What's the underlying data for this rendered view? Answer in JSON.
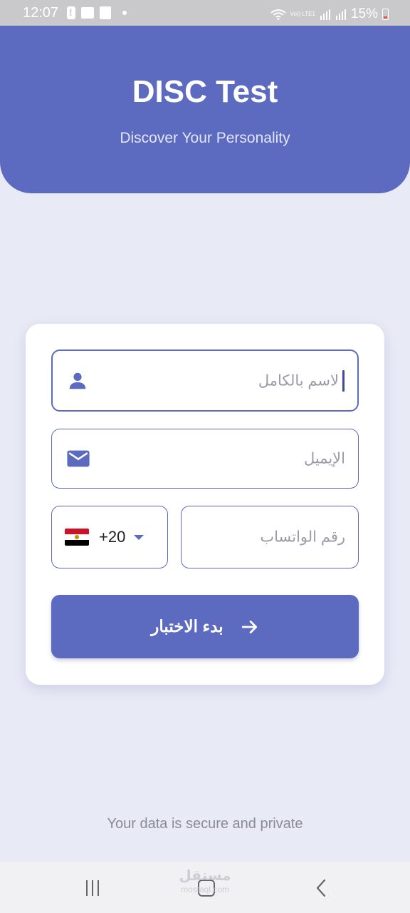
{
  "status_bar": {
    "time": "12:07",
    "volte_label": "Vo)) LTE1",
    "battery_text": "15%"
  },
  "header": {
    "title": "DISC Test",
    "subtitle": "Discover Your Personality"
  },
  "form": {
    "full_name": {
      "placeholder": "لاسم بالكامل",
      "icon": "person-icon"
    },
    "email": {
      "placeholder": "الإيميل",
      "icon": "mail-icon"
    },
    "phone": {
      "placeholder": "رقم الواتساب"
    },
    "country": {
      "dial_code": "+20",
      "flag": "egypt-flag-icon"
    },
    "submit_label": "بدء الاختبار",
    "submit_icon": "arrow-right-icon"
  },
  "footer_note": "Your data is secure and private",
  "watermark": {
    "text_ar": "مستقل",
    "text_en": "mostaql.com"
  },
  "colors": {
    "primary": "#5c6bc0",
    "background": "#e8eaf6",
    "card": "#ffffff"
  }
}
